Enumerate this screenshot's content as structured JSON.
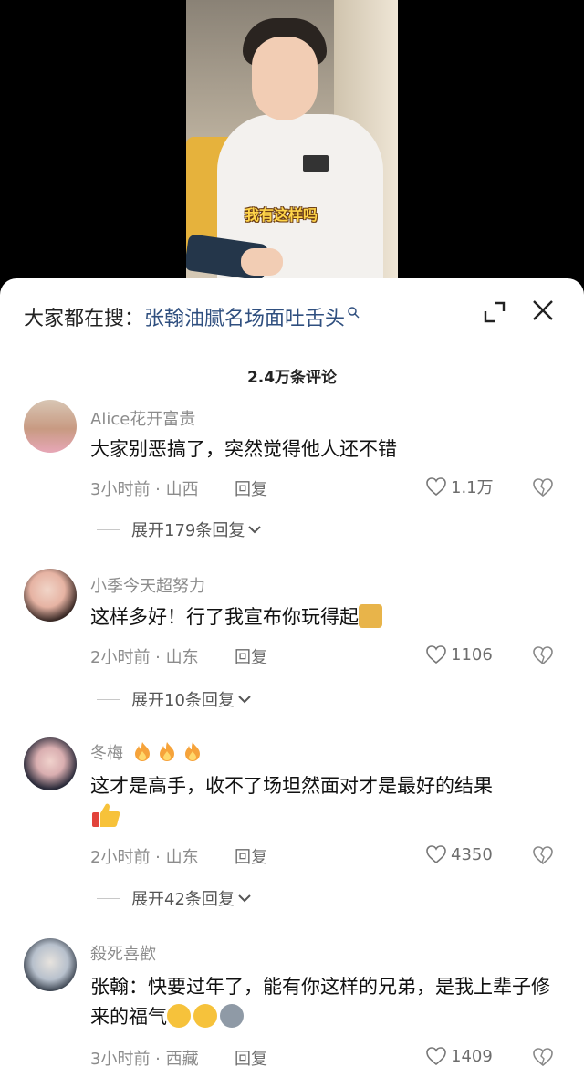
{
  "video": {
    "caption": "我有这样吗"
  },
  "search": {
    "prefix": "大家都在搜：",
    "term": "张翰油腻名场面吐舌头"
  },
  "comments_count": "2.4万条评论",
  "comments": [
    {
      "user": "Alice花开富贵",
      "text": "大家别恶搞了，突然觉得他人还不错",
      "meta": "3小时前 · 山西",
      "reply": "回复",
      "likes": "1.1万",
      "expand": "展开179条回复"
    },
    {
      "user": "小季今天超努力",
      "text": "这样多好！行了我宣布你玩得起",
      "meta": "2小时前 · 山东",
      "reply": "回复",
      "likes": "1106",
      "expand": "展开10条回复"
    },
    {
      "user": "冬梅",
      "text": "这才是高手，收不了场坦然面对才是最好的结果",
      "meta": "2小时前 · 山东",
      "reply": "回复",
      "likes": "4350",
      "expand": "展开42条回复"
    },
    {
      "user": "殺死喜歡",
      "text": "张翰：快要过年了，能有你这样的兄弟，是我上辈子修来的福气",
      "meta": "3小时前 · 西藏",
      "reply": "回复",
      "likes": "1409"
    }
  ],
  "icons": {
    "search": "search-icon",
    "expand": "expand-icon",
    "close": "close-icon",
    "like": "heart-icon",
    "dislike": "broken-heart-icon",
    "chevron": "chevron-down-icon",
    "fire": "fire-icon"
  }
}
